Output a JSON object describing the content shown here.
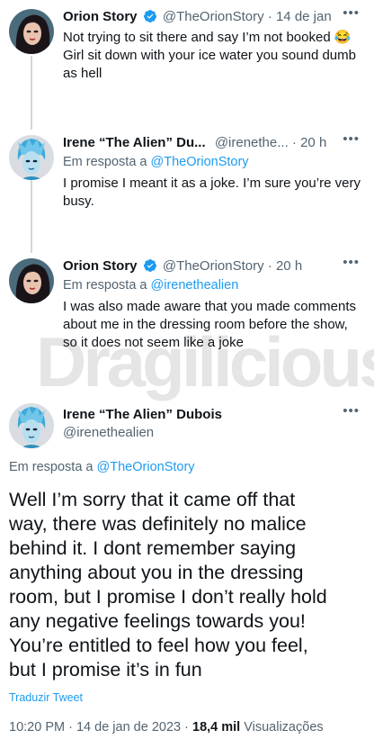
{
  "tweets": [
    {
      "name": "Orion Story",
      "handle": "@TheOrionStory",
      "time": "14 de jan",
      "line1": "Not trying to sit there and say I’m not booked 😂",
      "line2": "Girl sit down with your ice water you sound dumb",
      "line3": "as hell"
    },
    {
      "name": "Irene “The Alien” Du...",
      "handle": "@irenethe...",
      "time": "20 h",
      "reply_prefix": "Em resposta a",
      "reply_to": "@TheOrionStory",
      "line1": "I promise I meant it as a joke. I’m sure you’re very",
      "line2": "busy."
    },
    {
      "name": "Orion Story",
      "handle": "@TheOrionStory",
      "time": "20 h",
      "reply_prefix": "Em resposta a",
      "reply_to": "@irenethealien",
      "line1": "I was also made aware that you made comments",
      "line2": "about me in the dressing room before the show,",
      "line3": "so it does not seem like a joke"
    }
  ],
  "main_tweet": {
    "name": "Irene “The Alien” Dubois",
    "handle": "@irenethealien",
    "reply_prefix": "Em resposta a",
    "reply_to": "@TheOrionStory",
    "lines": [
      "Well I’m sorry that it came off that",
      "way, there was definitely no malice",
      "behind it. I dont remember saying",
      "anything about you in the dressing",
      "room, but I promise I don’t really hold",
      "any negative feelings towards you!",
      "You’re entitled to feel how you feel,",
      "but I promise it’s in fun"
    ],
    "translate": "Traduzir Tweet",
    "time": "10:20 PM",
    "date": "14 de jan de 2023",
    "views_count": "18,4 mil",
    "views_label": "Visualizações"
  },
  "more_label": "•••",
  "dot": "·",
  "watermark": "Dragilicious",
  "colors": {
    "accent": "#1d9bf0",
    "secondary_text": "#536471",
    "verified": "#1d9bf0"
  }
}
